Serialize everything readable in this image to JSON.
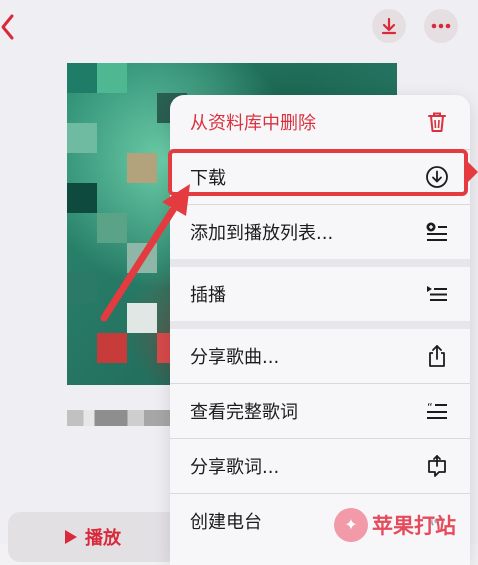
{
  "header": {
    "back_icon": "chevron-left-icon",
    "download_icon": "download-icon",
    "more_icon": "ellipsis-icon"
  },
  "player": {
    "play_label": "播放"
  },
  "menu": {
    "items": [
      {
        "label": "从资料库中删除",
        "icon": "trash-icon"
      },
      {
        "label": "下载",
        "icon": "download-circle-icon"
      },
      {
        "label": "添加到播放列表...",
        "icon": "add-to-playlist-icon"
      },
      {
        "label": "插播",
        "icon": "play-next-icon"
      },
      {
        "label": "分享歌曲...",
        "icon": "share-icon"
      },
      {
        "label": "查看完整歌词",
        "icon": "lyrics-icon"
      },
      {
        "label": "分享歌词...",
        "icon": "share-lyrics-icon"
      },
      {
        "label": "创建电台",
        "icon": "radio-icon"
      }
    ]
  },
  "watermark": {
    "text": "苹果打站"
  },
  "colors": {
    "accent_red": "#d92a3c",
    "highlight_red": "#e33b3f"
  }
}
